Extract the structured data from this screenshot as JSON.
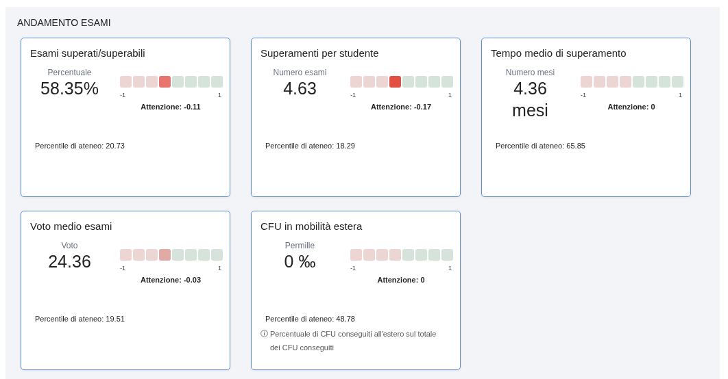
{
  "section_title": "ANDAMENTO ESAMI",
  "cards": [
    {
      "title": "Esami superati/superabili",
      "unit_label": "Percentuale",
      "value": "58.35%",
      "scale_min": "-1",
      "scale_max": "1",
      "attention": "Attenzione: -0.11",
      "percentile": "Percentile di ateneo: 20.73",
      "segments": [
        {
          "color": "#ecd5d2"
        },
        {
          "color": "#ecd5d2"
        },
        {
          "color": "#ecd5d2"
        },
        {
          "color": "#e8736f"
        },
        {
          "color": "#d5e3da"
        },
        {
          "color": "#d5e3da"
        },
        {
          "color": "#d5e3da"
        },
        {
          "color": "#d5e3da"
        }
      ]
    },
    {
      "title": "Superamenti per studente",
      "unit_label": "Numero esami",
      "value": "4.63",
      "scale_min": "-1",
      "scale_max": "1",
      "attention": "Attenzione: -0.17",
      "percentile": "Percentile di ateneo: 18.29",
      "segments": [
        {
          "color": "#ecd5d2"
        },
        {
          "color": "#ecd5d2"
        },
        {
          "color": "#ecd5d2"
        },
        {
          "color": "#e24f43"
        },
        {
          "color": "#d5e3da"
        },
        {
          "color": "#d5e3da"
        },
        {
          "color": "#d5e3da"
        },
        {
          "color": "#d5e3da"
        }
      ]
    },
    {
      "title": "Tempo medio di superamento",
      "unit_label": "Numero mesi",
      "value": "4.36 mesi",
      "scale_min": "-1",
      "scale_max": "1",
      "attention": "Attenzione: 0",
      "percentile": "Percentile di ateneo: 65.85",
      "segments": [
        {
          "color": "#ecd5d2"
        },
        {
          "color": "#ecd5d2"
        },
        {
          "color": "#ecd5d2"
        },
        {
          "color": "#ecd5d2"
        },
        {
          "color": "#d5e3da"
        },
        {
          "color": "#d5e3da"
        },
        {
          "color": "#d5e3da"
        },
        {
          "color": "#d5e3da"
        }
      ]
    },
    {
      "title": "Voto medio esami",
      "unit_label": "Voto",
      "value": "24.36",
      "scale_min": "-1",
      "scale_max": "1",
      "attention": "Attenzione: -0.03",
      "percentile": "Percentile di ateneo: 19.51",
      "segments": [
        {
          "color": "#ecd5d2"
        },
        {
          "color": "#ecd5d2"
        },
        {
          "color": "#ecd5d2"
        },
        {
          "color": "#e2aaa4"
        },
        {
          "color": "#d5e3da"
        },
        {
          "color": "#d5e3da"
        },
        {
          "color": "#d5e3da"
        },
        {
          "color": "#d5e3da"
        }
      ]
    },
    {
      "title": "CFU in mobilità estera",
      "unit_label": "Permille",
      "value": "0 ‰",
      "scale_min": "-1",
      "scale_max": "1",
      "attention": "Attenzione: 0",
      "percentile": "Percentile di ateneo: 48.78",
      "note": "Percentuale di CFU conseguiti all'estero sul totale dei CFU conseguiti",
      "segments": [
        {
          "color": "#ecd5d2"
        },
        {
          "color": "#ecd5d2"
        },
        {
          "color": "#ecd5d2"
        },
        {
          "color": "#ecd5d2"
        },
        {
          "color": "#d5e3da"
        },
        {
          "color": "#d5e3da"
        },
        {
          "color": "#d5e3da"
        },
        {
          "color": "#d5e3da"
        }
      ]
    }
  ]
}
